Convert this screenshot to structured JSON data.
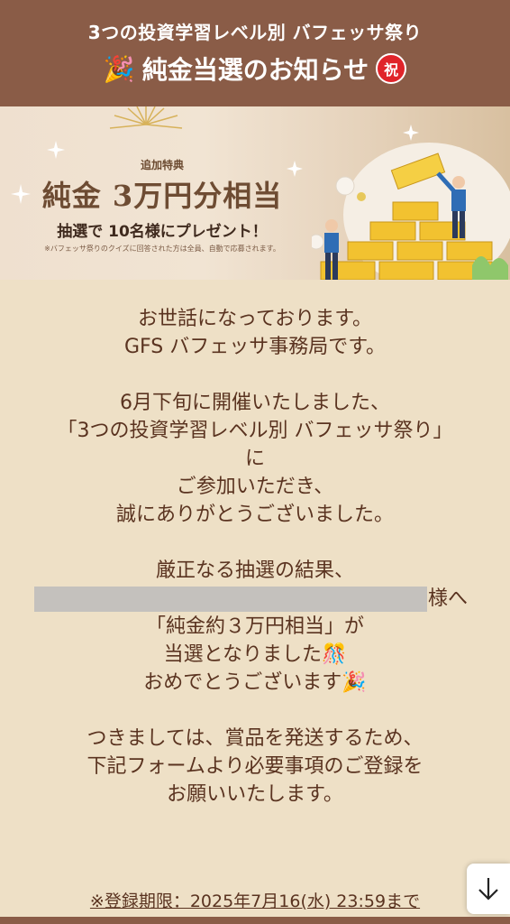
{
  "header": {
    "subtitle": "3つの投資学習レベル別 バフェッサ祭り",
    "title": "純金当選のお知らせ",
    "party_emoji": "🎉",
    "badge_text": "祝"
  },
  "banner": {
    "bonus_label": "追加特典",
    "headline": "純金 3万円分相当",
    "lottery_text": "抽選で 10名様にプレゼント！",
    "note": "※バフェッサ祭りのクイズに回答された方は全員、自動で応募されます。"
  },
  "body": {
    "greeting": [
      "お世話になっております。",
      "GFS バフェッサ事務局です。"
    ],
    "thanks": [
      "6月下旬に開催いたしました、",
      "「3つの投資学習レベル別 バフェッサ祭り」",
      "に",
      "ご参加いただき、",
      "誠にありがとうございました。"
    ],
    "result_line": "厳正なる抽選の結果、",
    "recipient_suffix": "様へ",
    "prize_lines": [
      "「純金約３万円相当」が",
      "当選となりました🎊",
      "おめでとうございます🎉"
    ],
    "request_lines": [
      "つきましては、賞品を発送するため、",
      "下記フォームより必要事項のご登録を",
      "お願いいたします。"
    ],
    "deadline": "※登録期限：2025年7月16(水) 23:59まで"
  },
  "colors": {
    "header_bg": "#8a5c47",
    "page_bg": "#eee0c6",
    "text": "#5a3320",
    "badge": "#e0242a"
  }
}
